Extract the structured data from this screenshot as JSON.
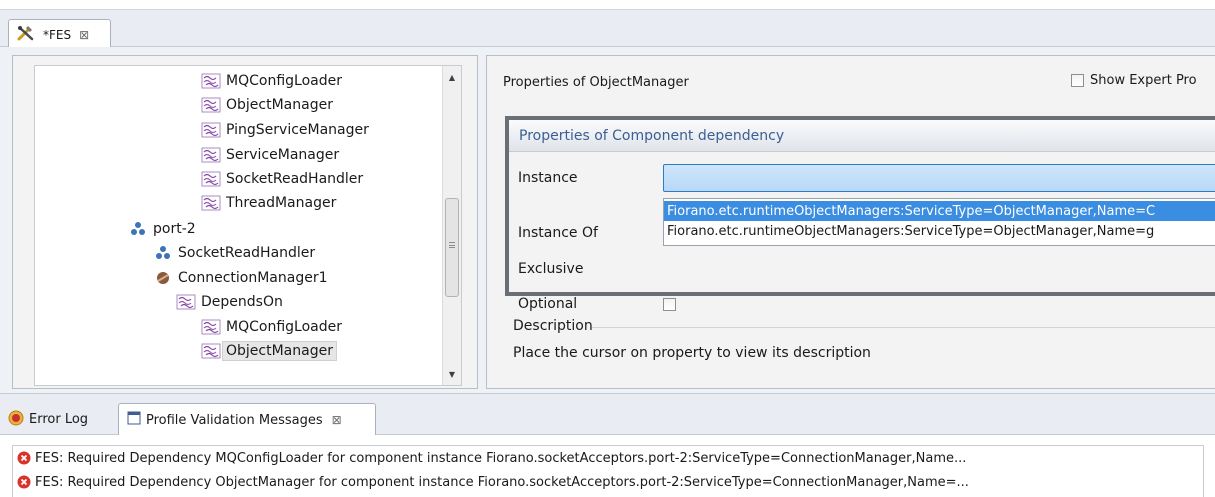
{
  "editor_tab": {
    "label": "*FES",
    "close_icon": "close-icon"
  },
  "tree": {
    "items": [
      {
        "label": "MQConfigLoader",
        "icon": "dependency-icon"
      },
      {
        "label": "ObjectManager",
        "icon": "dependency-icon"
      },
      {
        "label": "PingServiceManager",
        "icon": "dependency-icon"
      },
      {
        "label": "ServiceManager",
        "icon": "dependency-icon"
      },
      {
        "label": "SocketReadHandler",
        "icon": "dependency-icon"
      },
      {
        "label": "ThreadManager",
        "icon": "dependency-icon"
      },
      {
        "label": "port-2",
        "icon": "node-icon"
      },
      {
        "label": "SocketReadHandler",
        "icon": "node-icon"
      },
      {
        "label": "ConnectionManager1",
        "icon": "component-icon"
      },
      {
        "label": "DependsOn",
        "icon": "dependency-icon"
      },
      {
        "label": "MQConfigLoader",
        "icon": "dependency-icon"
      },
      {
        "label": "ObjectManager",
        "icon": "dependency-icon",
        "selected": true
      }
    ]
  },
  "properties": {
    "title": "Properties of ObjectManager",
    "expert_label": "Show Expert Pro",
    "expert_checked": false,
    "section_title": "Properties of Component dependency",
    "labels": {
      "instance": "Instance",
      "instance_of": "Instance Of",
      "exclusive": "Exclusive",
      "optional": "Optional"
    },
    "instance_value": "",
    "optional_checked": false,
    "dropdown_options": [
      "Fiorano.etc.runtimeObjectManagers:ServiceType=ObjectManager,Name=C",
      "Fiorano.etc.runtimeObjectManagers:ServiceType=ObjectManager,Name=g"
    ],
    "selected_option": 0
  },
  "description": {
    "title": "Description",
    "text": "Place the cursor on property to view its description"
  },
  "bottom_tabs": {
    "error_log": "Error Log",
    "profile_validation": "Profile Validation Messages"
  },
  "messages": [
    "FES: Required Dependency MQConfigLoader for component instance Fiorano.socketAcceptors.port-2:ServiceType=ConnectionManager,Name...",
    "FES: Required Dependency ObjectManager for component instance Fiorano.socketAcceptors.port-2:ServiceType=ConnectionManager,Name=..."
  ],
  "colors": {
    "selection": "#3a8de0",
    "section_title": "#3c5e93",
    "error": "#d9342b"
  }
}
